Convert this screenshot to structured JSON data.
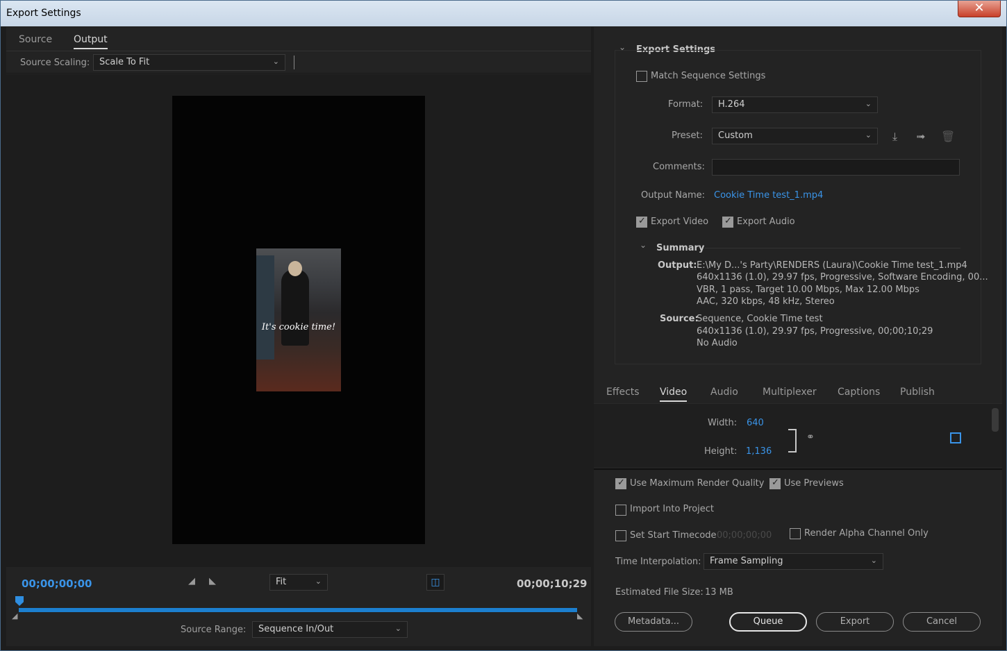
{
  "window": {
    "title": "Export Settings",
    "close_label": "✕"
  },
  "left": {
    "tabs": [
      "Source",
      "Output"
    ],
    "source_scaling_label": "Source Scaling:",
    "source_scaling_value": "Scale To Fit",
    "preview_caption": "It's cookie time!",
    "timecode_start": "00;00;00;00",
    "timecode_end": "00;00;10;29",
    "zoom_value": "Fit",
    "source_range_label": "Source Range:",
    "source_range_value": "Sequence In/Out"
  },
  "export": {
    "section_title": "Export Settings",
    "match_sequence_label": "Match Sequence Settings",
    "format_label": "Format:",
    "format_value": "H.264",
    "preset_label": "Preset:",
    "preset_value": "Custom",
    "comments_label": "Comments:",
    "output_name_label": "Output Name:",
    "output_name_value": "Cookie Time test_1.mp4",
    "export_video_label": "Export Video",
    "export_audio_label": "Export Audio",
    "summary_title": "Summary",
    "output_label": "Output:",
    "output_lines": [
      "E:\\My D...'s Party\\RENDERS (Laura)\\Cookie Time test_1.mp4",
      "640x1136 (1.0), 29.97 fps, Progressive, Software Encoding, 00...",
      "VBR, 1 pass, Target 10.00 Mbps, Max 12.00 Mbps",
      "AAC, 320 kbps, 48 kHz, Stereo"
    ],
    "source_label": "Source:",
    "source_lines": [
      "Sequence, Cookie Time test",
      "640x1136 (1.0), 29.97 fps, Progressive, 00;00;10;29",
      "No Audio"
    ]
  },
  "sub_tabs": [
    "Effects",
    "Video",
    "Audio",
    "Multiplexer",
    "Captions",
    "Publish"
  ],
  "video": {
    "width_label": "Width:",
    "width_value": "640",
    "height_label": "Height:",
    "height_value": "1,136"
  },
  "bottom": {
    "max_render_label": "Use Maximum Render Quality",
    "use_previews_label": "Use Previews",
    "import_label": "Import Into Project",
    "set_start_label": "Set Start Timecode",
    "start_timecode_value": "00;00;00;00",
    "alpha_label": "Render Alpha Channel Only",
    "time_interp_label": "Time Interpolation:",
    "time_interp_value": "Frame Sampling",
    "file_size_label": "Estimated File Size:",
    "file_size_value": "13 MB",
    "metadata_btn": "Metadata...",
    "queue_btn": "Queue",
    "export_btn": "Export",
    "cancel_btn": "Cancel"
  }
}
